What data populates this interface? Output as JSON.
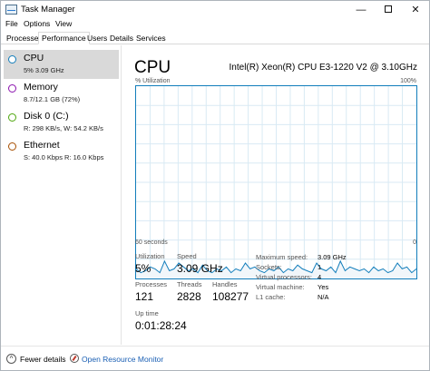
{
  "window": {
    "title": "Task Manager",
    "minimize_glyph": "—",
    "close_glyph": "✕"
  },
  "menu": [
    "File",
    "Options",
    "View"
  ],
  "tabs": [
    {
      "label": "Processes",
      "active": false
    },
    {
      "label": "Performance",
      "active": true
    },
    {
      "label": "Users",
      "active": false
    },
    {
      "label": "Details",
      "active": false
    },
    {
      "label": "Services",
      "active": false
    }
  ],
  "sidebar": {
    "items": [
      {
        "name": "CPU",
        "detail": "5%  3.09 GHz",
        "color": "#117dbb",
        "selected": true
      },
      {
        "name": "Memory",
        "detail": "8.7/12.1 GB (72%)",
        "color": "#8b12ae",
        "selected": false
      },
      {
        "name": "Disk 0 (C:)",
        "detail": "R: 298 KB/s, W: 54.2 KB/s",
        "color": "#4da60c",
        "selected": false
      },
      {
        "name": "Ethernet",
        "detail": "S: 40.0 Kbps  R: 16.0 Kbps",
        "color": "#a74f01",
        "selected": false
      }
    ]
  },
  "main": {
    "title": "CPU",
    "model": "Intel(R) Xeon(R) CPU E3-1220 V2 @ 3.10GHz",
    "util_label": "% Utilization",
    "util_max": "100%",
    "axis_left": "60 seconds",
    "axis_right": "0",
    "graph_color": "#117dbb",
    "graph_fill": "#f1f6fa",
    "grid_color": "#d9eaf4",
    "utilization_history": [
      5,
      3,
      4,
      6,
      5,
      3,
      9,
      4,
      5,
      8,
      6,
      4,
      5,
      3,
      7,
      4,
      3,
      5,
      4,
      6,
      3,
      5,
      4,
      8,
      5,
      6,
      4,
      3,
      5,
      4,
      6,
      3,
      5,
      4,
      7,
      5,
      4,
      3,
      8,
      5,
      4,
      6,
      3,
      9,
      4,
      6,
      5,
      4,
      5,
      3,
      6,
      4,
      5,
      3,
      4,
      8,
      5,
      6,
      3,
      5
    ],
    "stats": {
      "utilization_label": "Utilization",
      "utilization": "5%",
      "speed_label": "Speed",
      "speed": "3.09 GHz",
      "processes_label": "Processes",
      "processes": "121",
      "threads_label": "Threads",
      "threads": "2828",
      "handles_label": "Handles",
      "handles": "108277",
      "uptime_label": "Up time",
      "uptime": "0:01:28:24"
    },
    "details": [
      {
        "key": "Maximum speed:",
        "value": "3.09 GHz"
      },
      {
        "key": "Sockets:",
        "value": "1"
      },
      {
        "key": "Virtual processors:",
        "value": "4"
      },
      {
        "key": "Virtual machine:",
        "value": "Yes"
      },
      {
        "key": "L1 cache:",
        "value": "N/A"
      }
    ]
  },
  "footer": {
    "fewer_details": "Fewer details",
    "resource_monitor": "Open Resource Monitor"
  }
}
